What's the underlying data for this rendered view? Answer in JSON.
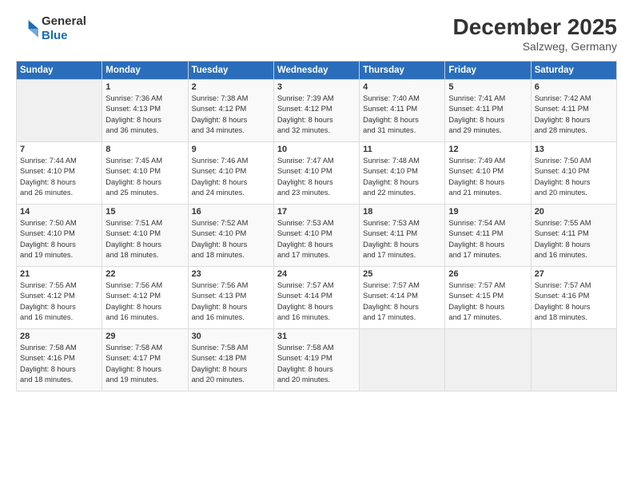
{
  "header": {
    "logo_line1": "General",
    "logo_line2": "Blue",
    "month": "December 2025",
    "location": "Salzweg, Germany"
  },
  "days_of_week": [
    "Sunday",
    "Monday",
    "Tuesday",
    "Wednesday",
    "Thursday",
    "Friday",
    "Saturday"
  ],
  "weeks": [
    [
      {
        "day": "",
        "info": ""
      },
      {
        "day": "1",
        "info": "Sunrise: 7:36 AM\nSunset: 4:13 PM\nDaylight: 8 hours\nand 36 minutes."
      },
      {
        "day": "2",
        "info": "Sunrise: 7:38 AM\nSunset: 4:12 PM\nDaylight: 8 hours\nand 34 minutes."
      },
      {
        "day": "3",
        "info": "Sunrise: 7:39 AM\nSunset: 4:12 PM\nDaylight: 8 hours\nand 32 minutes."
      },
      {
        "day": "4",
        "info": "Sunrise: 7:40 AM\nSunset: 4:11 PM\nDaylight: 8 hours\nand 31 minutes."
      },
      {
        "day": "5",
        "info": "Sunrise: 7:41 AM\nSunset: 4:11 PM\nDaylight: 8 hours\nand 29 minutes."
      },
      {
        "day": "6",
        "info": "Sunrise: 7:42 AM\nSunset: 4:11 PM\nDaylight: 8 hours\nand 28 minutes."
      }
    ],
    [
      {
        "day": "7",
        "info": "Sunrise: 7:44 AM\nSunset: 4:10 PM\nDaylight: 8 hours\nand 26 minutes."
      },
      {
        "day": "8",
        "info": "Sunrise: 7:45 AM\nSunset: 4:10 PM\nDaylight: 8 hours\nand 25 minutes."
      },
      {
        "day": "9",
        "info": "Sunrise: 7:46 AM\nSunset: 4:10 PM\nDaylight: 8 hours\nand 24 minutes."
      },
      {
        "day": "10",
        "info": "Sunrise: 7:47 AM\nSunset: 4:10 PM\nDaylight: 8 hours\nand 23 minutes."
      },
      {
        "day": "11",
        "info": "Sunrise: 7:48 AM\nSunset: 4:10 PM\nDaylight: 8 hours\nand 22 minutes."
      },
      {
        "day": "12",
        "info": "Sunrise: 7:49 AM\nSunset: 4:10 PM\nDaylight: 8 hours\nand 21 minutes."
      },
      {
        "day": "13",
        "info": "Sunrise: 7:50 AM\nSunset: 4:10 PM\nDaylight: 8 hours\nand 20 minutes."
      }
    ],
    [
      {
        "day": "14",
        "info": "Sunrise: 7:50 AM\nSunset: 4:10 PM\nDaylight: 8 hours\nand 19 minutes."
      },
      {
        "day": "15",
        "info": "Sunrise: 7:51 AM\nSunset: 4:10 PM\nDaylight: 8 hours\nand 18 minutes."
      },
      {
        "day": "16",
        "info": "Sunrise: 7:52 AM\nSunset: 4:10 PM\nDaylight: 8 hours\nand 18 minutes."
      },
      {
        "day": "17",
        "info": "Sunrise: 7:53 AM\nSunset: 4:10 PM\nDaylight: 8 hours\nand 17 minutes."
      },
      {
        "day": "18",
        "info": "Sunrise: 7:53 AM\nSunset: 4:11 PM\nDaylight: 8 hours\nand 17 minutes."
      },
      {
        "day": "19",
        "info": "Sunrise: 7:54 AM\nSunset: 4:11 PM\nDaylight: 8 hours\nand 17 minutes."
      },
      {
        "day": "20",
        "info": "Sunrise: 7:55 AM\nSunset: 4:11 PM\nDaylight: 8 hours\nand 16 minutes."
      }
    ],
    [
      {
        "day": "21",
        "info": "Sunrise: 7:55 AM\nSunset: 4:12 PM\nDaylight: 8 hours\nand 16 minutes."
      },
      {
        "day": "22",
        "info": "Sunrise: 7:56 AM\nSunset: 4:12 PM\nDaylight: 8 hours\nand 16 minutes."
      },
      {
        "day": "23",
        "info": "Sunrise: 7:56 AM\nSunset: 4:13 PM\nDaylight: 8 hours\nand 16 minutes."
      },
      {
        "day": "24",
        "info": "Sunrise: 7:57 AM\nSunset: 4:14 PM\nDaylight: 8 hours\nand 16 minutes."
      },
      {
        "day": "25",
        "info": "Sunrise: 7:57 AM\nSunset: 4:14 PM\nDaylight: 8 hours\nand 17 minutes."
      },
      {
        "day": "26",
        "info": "Sunrise: 7:57 AM\nSunset: 4:15 PM\nDaylight: 8 hours\nand 17 minutes."
      },
      {
        "day": "27",
        "info": "Sunrise: 7:57 AM\nSunset: 4:16 PM\nDaylight: 8 hours\nand 18 minutes."
      }
    ],
    [
      {
        "day": "28",
        "info": "Sunrise: 7:58 AM\nSunset: 4:16 PM\nDaylight: 8 hours\nand 18 minutes."
      },
      {
        "day": "29",
        "info": "Sunrise: 7:58 AM\nSunset: 4:17 PM\nDaylight: 8 hours\nand 19 minutes."
      },
      {
        "day": "30",
        "info": "Sunrise: 7:58 AM\nSunset: 4:18 PM\nDaylight: 8 hours\nand 20 minutes."
      },
      {
        "day": "31",
        "info": "Sunrise: 7:58 AM\nSunset: 4:19 PM\nDaylight: 8 hours\nand 20 minutes."
      },
      {
        "day": "",
        "info": ""
      },
      {
        "day": "",
        "info": ""
      },
      {
        "day": "",
        "info": ""
      }
    ]
  ]
}
